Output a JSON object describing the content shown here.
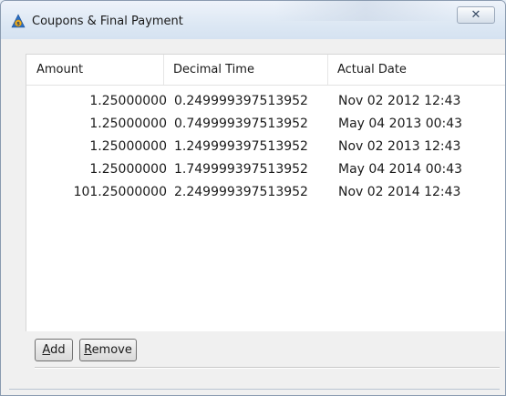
{
  "window": {
    "title": "Coupons & Final Payment",
    "close_label": "✕"
  },
  "table": {
    "columns": [
      "Amount",
      "Decimal Time",
      "Actual Date"
    ],
    "rows": [
      [
        "1.25000000",
        "0.249999397513952",
        "Nov 02 2012 12:43"
      ],
      [
        "1.25000000",
        "0.749999397513952",
        "May 04 2013 00:43"
      ],
      [
        "1.25000000",
        "1.249999397513952",
        "Nov 02 2013 12:43"
      ],
      [
        "1.25000000",
        "1.749999397513952",
        "May 04 2014 00:43"
      ],
      [
        "101.25000000",
        "2.249999397513952",
        "Nov 02 2014 12:43"
      ]
    ]
  },
  "buttons": {
    "add": {
      "mnemonic": "A",
      "rest": "dd"
    },
    "remove": {
      "mnemonic": "R",
      "rest": "emove"
    }
  },
  "colors": {
    "accent_icon": "#2a6ec2",
    "icon_badge": "#e0a21a"
  }
}
